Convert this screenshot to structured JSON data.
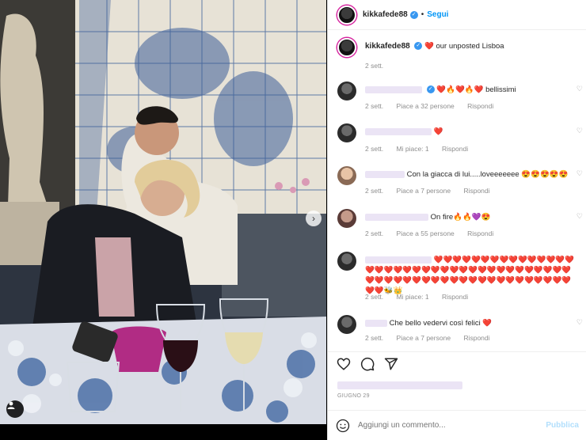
{
  "post": {
    "username": "kikkafede88",
    "follow_label": "Segui",
    "separator": "•"
  },
  "caption": {
    "username": "kikkafede88",
    "text": "our unposted Lisboa",
    "emoji": "❤️",
    "time": "2 sett."
  },
  "comments": [
    {
      "text": "❤️🔥❤️🔥❤️ bellissimi",
      "time": "2 sett.",
      "likes": "Piace a 32 persone",
      "reply": "Rispondi"
    },
    {
      "text": "❤️",
      "time": "2 sett.",
      "likes": "Mi piace: 1",
      "reply": "Rispondi"
    },
    {
      "text": "Con la giacca di lui.....loveeeeeee 😍😍😍😍😍",
      "time": "2 sett.",
      "likes": "Piace a 7 persone",
      "reply": "Rispondi"
    },
    {
      "text": "On fire🔥🔥💜😍",
      "time": "2 sett.",
      "likes": "Piace a 55 persone",
      "reply": "Rispondi"
    },
    {
      "text": "❤️❤️❤️❤️❤️❤️❤️❤️❤️❤️❤️❤️❤️❤️❤️❤️❤️❤️❤️❤️❤️❤️❤️❤️❤️❤️❤️❤️❤️❤️❤️❤️❤️❤️❤️❤️❤️❤️❤️❤️❤️❤️❤️❤️❤️❤️❤️❤️❤️❤️❤️❤️❤️❤️❤️❤️❤️❤️❤️❤️❤️🐝👑",
      "time": "2 sett.",
      "likes": "Mi piace: 1",
      "reply": "Rispondi"
    },
    {
      "text": "Che bello vedervi così felici ❤️",
      "time": "2 sett.",
      "likes": "Piace a 7 persone",
      "reply": "Rispondi"
    }
  ],
  "footer": {
    "date": "GIUGNO 29",
    "add_comment_placeholder": "Aggiungi un commento...",
    "post_label": "Pubblica"
  },
  "icons": {
    "like": "heart-icon",
    "comment": "comment-icon",
    "share": "share-icon",
    "emoji": "emoji-icon",
    "next": "chevron-right-icon",
    "tag": "user-tag-icon"
  },
  "colors": {
    "link": "#0095f6",
    "verified": "#3897f0",
    "muted": "#8e8e8e",
    "heart": "#ed4956"
  }
}
